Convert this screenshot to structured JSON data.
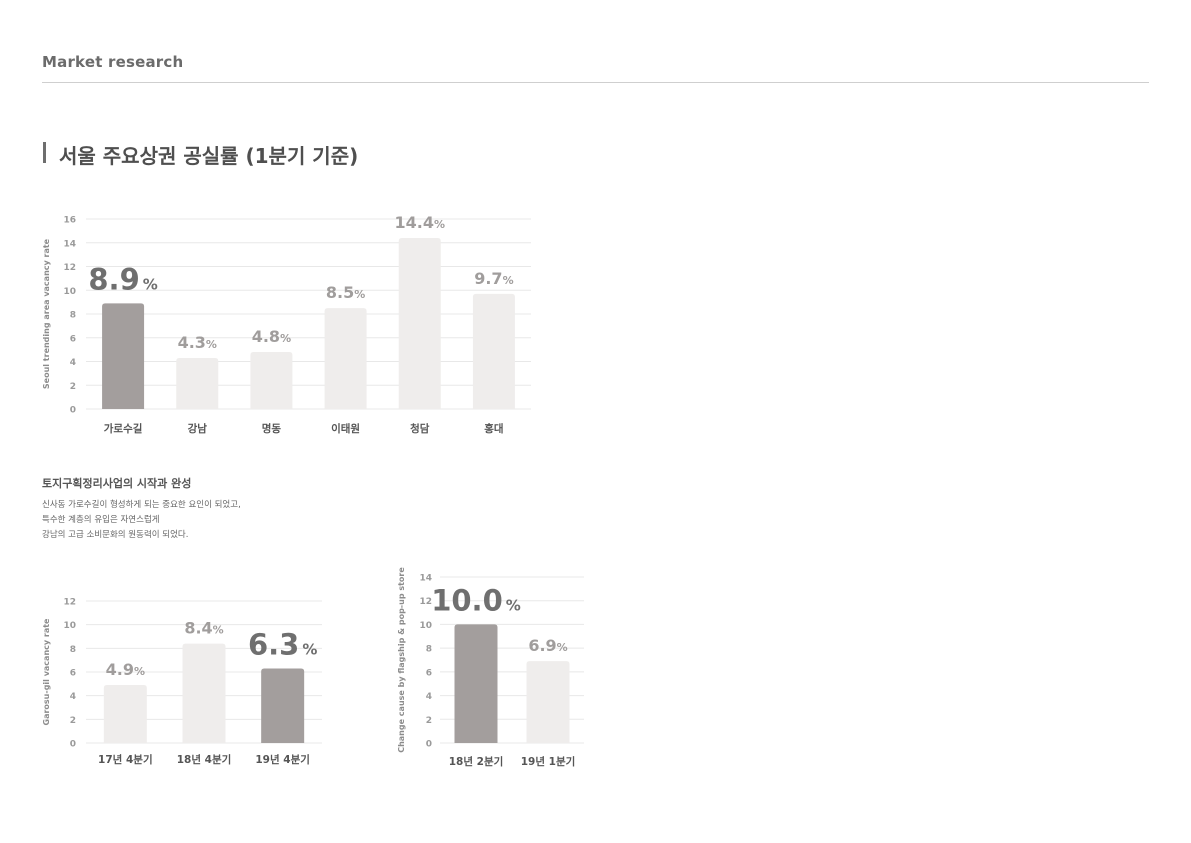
{
  "header": {
    "label": "Market research"
  },
  "page_title": "서울 주요상권 공실률 (1분기 기준)",
  "section": {
    "title": "토지구획정리사업의 시작과 완성",
    "lines": [
      "신사동 가로수길이 형성하게 되는 중요한 요인이 되었고,",
      "특수한 계층의 유입은 자연스럽게",
      "강남의 고급 소비문화의 원동력이 되었다."
    ]
  },
  "colors": {
    "highlight_bar": "#a39e9d",
    "normal_bar": "#efedec",
    "highlight_label": "#6f6f6f",
    "normal_label": "#a09d9c",
    "grid": "#e8e8e8",
    "axis_text": "#9a9a9a"
  },
  "chart_data": [
    {
      "type": "bar",
      "ylabel": "Seoul trending area vacancy rate",
      "categories": [
        "가로수길",
        "강남",
        "명동",
        "이태원",
        "청담",
        "홍대"
      ],
      "values": [
        8.9,
        4.3,
        4.8,
        8.5,
        14.4,
        9.7
      ],
      "value_labels": [
        "8.9",
        "4.3",
        "4.8",
        "8.5",
        "14.4",
        "9.7"
      ],
      "unit": "%",
      "highlight_index": 0,
      "ylim": [
        0,
        16
      ],
      "yticks": [
        0,
        2,
        4,
        6,
        8,
        10,
        12,
        14,
        16
      ],
      "grid": true
    },
    {
      "type": "bar",
      "ylabel": "Garosu-gil vacancy rate",
      "categories": [
        "17년 4분기",
        "18년 4분기",
        "19년 4분기"
      ],
      "values": [
        4.9,
        8.4,
        6.3
      ],
      "value_labels": [
        "4.9",
        "8.4",
        "6.3"
      ],
      "unit": "%",
      "highlight_index": 2,
      "ylim": [
        0,
        12
      ],
      "yticks": [
        0,
        2,
        4,
        6,
        8,
        10,
        12
      ],
      "grid": true
    },
    {
      "type": "bar",
      "ylabel": "Change cause by flagship & pop-up store",
      "categories": [
        "18년 2분기",
        "19년 1분기"
      ],
      "values": [
        10.0,
        6.9
      ],
      "value_labels": [
        "10.0",
        "6.9"
      ],
      "unit": "%",
      "highlight_index": 0,
      "ylim": [
        0,
        14
      ],
      "yticks": [
        0,
        2,
        4,
        6,
        8,
        10,
        12,
        14
      ],
      "grid": true
    }
  ]
}
